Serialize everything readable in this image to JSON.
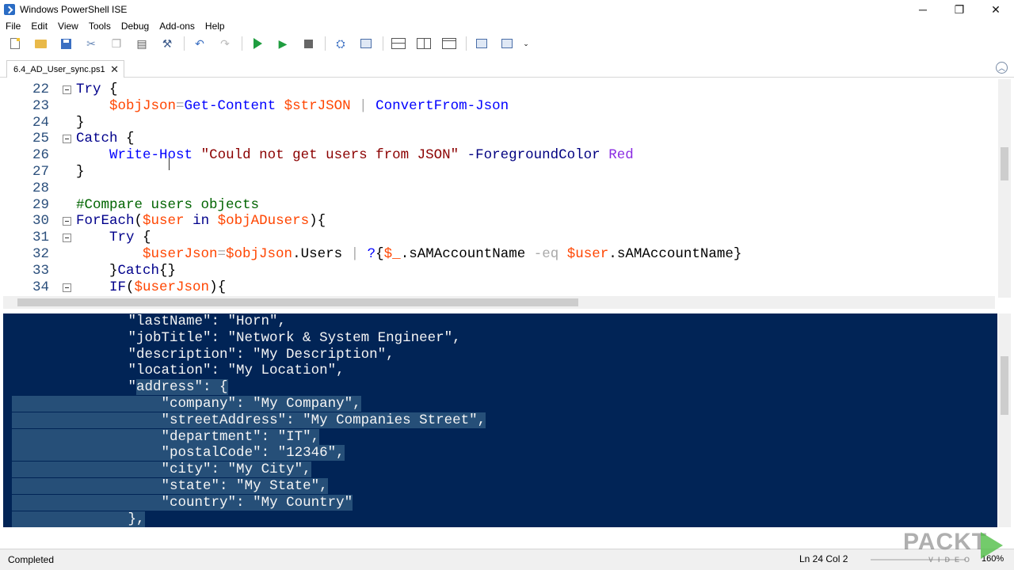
{
  "window": {
    "title": "Windows PowerShell ISE",
    "minimize": "─",
    "maximize": "❐",
    "close": "✕"
  },
  "menu": [
    "File",
    "Edit",
    "View",
    "Tools",
    "Debug",
    "Add-ons",
    "Help"
  ],
  "tab": {
    "label": "6.4_AD_User_sync.ps1",
    "close": "✕"
  },
  "editor": {
    "lines": [
      {
        "num": "22",
        "fold": true,
        "html": "<span class='kw'>Try</span> {"
      },
      {
        "num": "23",
        "fold": false,
        "html": "    <span class='var'>$objJson</span><span class='op'>=</span><span class='cmd'>Get-Content</span> <span class='var'>$strJSON</span> <span class='op'>|</span> <span class='cmd'>ConvertFrom-Json</span>"
      },
      {
        "num": "24",
        "fold": false,
        "html": "}"
      },
      {
        "num": "25",
        "fold": true,
        "html": "<span class='kw'>Catch</span> {"
      },
      {
        "num": "26",
        "fold": false,
        "html": "    <span class='cmd'>Write-Host</span> <span class='str'>\"Could not get users from JSON\"</span> <span class='param'>-ForegroundColor</span> <span class='typ'>Red</span>"
      },
      {
        "num": "27",
        "fold": false,
        "html": "}"
      },
      {
        "num": "28",
        "fold": false,
        "html": ""
      },
      {
        "num": "29",
        "fold": false,
        "html": "<span class='cmt'>#Compare users objects</span>"
      },
      {
        "num": "30",
        "fold": true,
        "html": "<span class='kw'>ForEach</span>(<span class='var'>$user</span> <span class='kw'>in</span> <span class='var'>$objADusers</span>){"
      },
      {
        "num": "31",
        "fold": true,
        "html": "    <span class='kw'>Try</span> {"
      },
      {
        "num": "32",
        "fold": false,
        "html": "        <span class='var'>$userJson</span><span class='op'>=</span><span class='var'>$objJson</span>.<span class='prop'>Users</span> <span class='op'>|</span> <span class='cmd'>?</span>{<span class='var'>$_</span>.<span class='prop'>sAMAccountName</span> <span class='op'>-eq</span> <span class='var'>$user</span>.<span class='prop'>sAMAccountName</span>}"
      },
      {
        "num": "33",
        "fold": false,
        "html": "    }<span class='kw'>Catch</span>{}"
      },
      {
        "num": "34",
        "fold": true,
        "html": "    <span class='kw'>IF</span>(<span class='var'>$userJson</span>){"
      }
    ]
  },
  "console": {
    "lines": [
      {
        "pre": "            ",
        "sel": "\"lastName\": \"Horn\",",
        "selFrom": "none"
      },
      {
        "pre": "            ",
        "sel": "\"jobTitle\": \"Network & System Engineer\",",
        "selFrom": "none"
      },
      {
        "pre": "            ",
        "sel": "\"description\": \"My Description\",",
        "selFrom": "none"
      },
      {
        "pre": "            ",
        "sel": "\"location\": \"My Location\",",
        "selFrom": "none"
      },
      {
        "pre": "            \"",
        "sel": "address\": {",
        "selFrom": "partial"
      },
      {
        "pre": "",
        "sel": "                \"company\": \"My Company\",",
        "selFrom": "full"
      },
      {
        "pre": "",
        "sel": "                \"streetAddress\": \"My Companies Street\",",
        "selFrom": "full"
      },
      {
        "pre": "",
        "sel": "                \"department\": \"IT\",",
        "selFrom": "full"
      },
      {
        "pre": "",
        "sel": "                \"postalCode\": \"12346\",",
        "selFrom": "full"
      },
      {
        "pre": "",
        "sel": "                \"city\": \"My City\",",
        "selFrom": "full"
      },
      {
        "pre": "",
        "sel": "                \"state\": \"My State\",",
        "selFrom": "full"
      },
      {
        "pre": "",
        "sel": "                \"country\": \"My Country\"",
        "selFrom": "full"
      },
      {
        "pre": "",
        "sel": "            },",
        "selFrom": "full"
      }
    ]
  },
  "status": {
    "text": "Completed",
    "position": "Ln 24  Col 2",
    "zoom": "160%"
  },
  "watermark": {
    "brand": "PACKT",
    "sub": "VIDEO"
  },
  "colors": {
    "console_bg": "#012456",
    "selection": "#264f78"
  }
}
